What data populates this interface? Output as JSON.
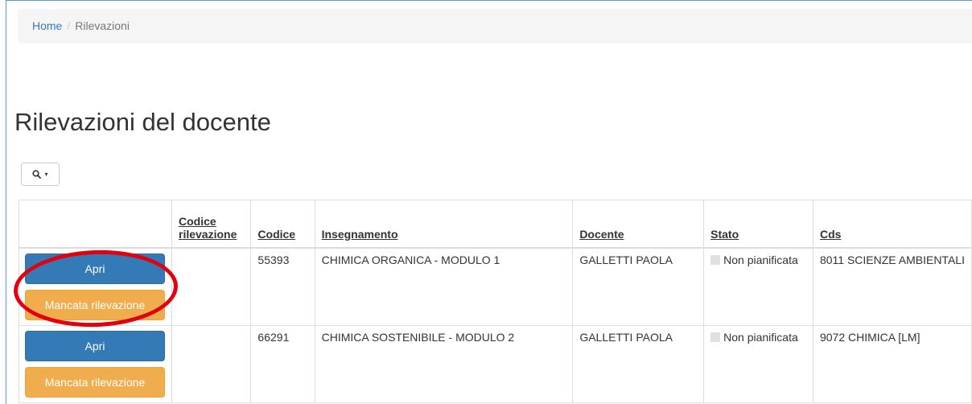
{
  "breadcrumb": {
    "home": "Home",
    "separator": "/",
    "current": "Rilevazioni"
  },
  "page": {
    "title": "Rilevazioni del docente"
  },
  "toolbar": {
    "search_icon": "search-icon",
    "caret": "▾"
  },
  "table": {
    "headers": {
      "actions": "",
      "codice_rilevazione_line1": "Codice",
      "codice_rilevazione_line2": "rilevazione",
      "codice": "Codice",
      "insegnamento": "Insegnamento",
      "docente": "Docente",
      "stato": "Stato",
      "cds": "Cds"
    },
    "rows": [
      {
        "apri": "Apri",
        "mancata": "Mancata rilevazione",
        "codice_rilevazione": "",
        "codice": "55393",
        "insegnamento": "CHIMICA ORGANICA - MODULO 1",
        "docente": "GALLETTI PAOLA",
        "stato": "Non pianificata",
        "cds": "8011 SCIENZE AMBIENTALI"
      },
      {
        "apri": "Apri",
        "mancata": "Mancata rilevazione",
        "codice_rilevazione": "",
        "codice": "66291",
        "insegnamento": "CHIMICA SOSTENIBILE - MODULO 2",
        "docente": "GALLETTI PAOLA",
        "stato": "Non pianificata",
        "cds": "9072 CHIMICA [LM]"
      }
    ]
  },
  "colors": {
    "primary": "#337ab7",
    "warning": "#f0ad4e",
    "annotation": "#e3000f",
    "link": "#337ab7"
  }
}
